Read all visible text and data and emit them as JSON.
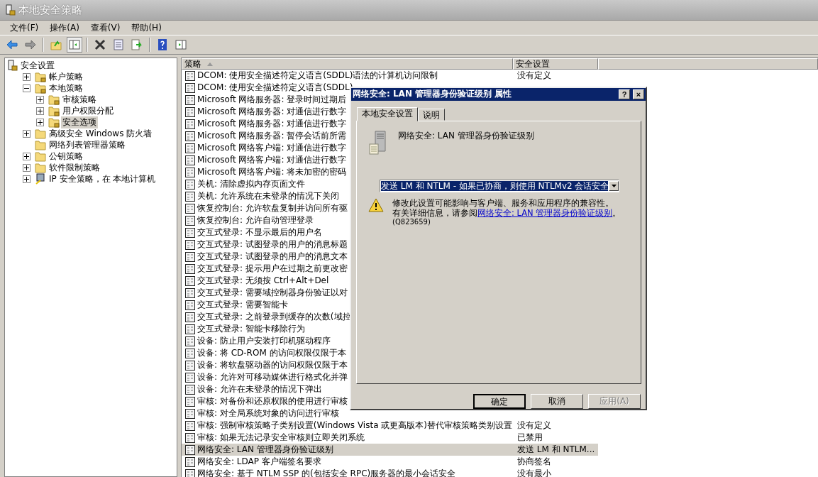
{
  "window": {
    "title": "本地安全策略"
  },
  "menu": [
    "文件(F)",
    "操作(A)",
    "查看(V)",
    "帮助(H)"
  ],
  "tree": [
    {
      "label": "安全设置",
      "kind": "root",
      "selected": false,
      "children": [
        {
          "label": "帐户策略",
          "kind": "policy",
          "selected": false,
          "expanded": false
        },
        {
          "label": "本地策略",
          "kind": "policy",
          "selected": false,
          "expanded": true,
          "children": [
            {
              "label": "审核策略",
              "kind": "policy",
              "selected": false,
              "expanded": false
            },
            {
              "label": "用户权限分配",
              "kind": "policy",
              "selected": false,
              "expanded": false
            },
            {
              "label": "安全选项",
              "kind": "policy",
              "selected": true,
              "expanded": false
            }
          ]
        },
        {
          "label": "高级安全 Windows 防火墙",
          "kind": "folder",
          "selected": false,
          "expanded": false
        },
        {
          "label": "网络列表管理器策略",
          "kind": "leaf",
          "selected": false
        },
        {
          "label": "公钥策略",
          "kind": "folder",
          "selected": false,
          "expanded": false
        },
        {
          "label": "软件限制策略",
          "kind": "folder",
          "selected": false,
          "expanded": false
        },
        {
          "label": "IP 安全策略，在 本地计算机",
          "kind": "ip",
          "selected": false,
          "expanded": false
        }
      ]
    }
  ],
  "table": {
    "columns": [
      "策略",
      "安全设置"
    ],
    "rows": [
      {
        "policy": "DCOM: 使用安全描述符定义语言(SDDL)语法的计算机访问限制",
        "setting": "没有定义",
        "selected": false
      },
      {
        "policy": "DCOM: 使用安全描述符定义语言(SDDL)",
        "selected": false
      },
      {
        "policy": "Microsoft 网络服务器: 登录时间过期后",
        "selected": false
      },
      {
        "policy": "Microsoft 网络服务器: 对通信进行数字",
        "selected": false
      },
      {
        "policy": "Microsoft 网络服务器: 对通信进行数字",
        "selected": false
      },
      {
        "policy": "Microsoft 网络服务器: 暂停会话前所需",
        "selected": false
      },
      {
        "policy": "Microsoft 网络客户端: 对通信进行数字",
        "selected": false
      },
      {
        "policy": "Microsoft 网络客户端: 对通信进行数字",
        "selected": false
      },
      {
        "policy": "Microsoft 网络客户端: 将未加密的密码",
        "selected": false
      },
      {
        "policy": "关机: 清除虚拟内存页面文件",
        "selected": false
      },
      {
        "policy": "关机: 允许系统在未登录的情况下关闭",
        "selected": false
      },
      {
        "policy": "恢复控制台: 允许软盘复制并访问所有驱",
        "selected": false
      },
      {
        "policy": "恢复控制台: 允许自动管理登录",
        "selected": false
      },
      {
        "policy": "交互式登录: 不显示最后的用户名",
        "selected": false
      },
      {
        "policy": "交互式登录: 试图登录的用户的消息标题",
        "selected": false
      },
      {
        "policy": "交互式登录: 试图登录的用户的消息文本",
        "selected": false
      },
      {
        "policy": "交互式登录: 提示用户在过期之前更改密",
        "selected": false
      },
      {
        "policy": "交互式登录: 无须按 Ctrl+Alt+Del",
        "selected": false
      },
      {
        "policy": "交互式登录: 需要域控制器身份验证以对",
        "selected": false
      },
      {
        "policy": "交互式登录: 需要智能卡",
        "selected": false
      },
      {
        "policy": "交互式登录: 之前登录到缓存的次数(域控",
        "selected": false
      },
      {
        "policy": "交互式登录: 智能卡移除行为",
        "selected": false
      },
      {
        "policy": "设备: 防止用户安装打印机驱动程序",
        "selected": false
      },
      {
        "policy": "设备: 将 CD-ROM 的访问权限仅限于本",
        "selected": false
      },
      {
        "policy": "设备: 将软盘驱动器的访问权限仅限于本",
        "selected": false
      },
      {
        "policy": "设备: 允许对可移动媒体进行格式化并弹",
        "selected": false
      },
      {
        "policy": "设备: 允许在未登录的情况下弹出",
        "selected": false
      },
      {
        "policy": "审核: 对备份和还原权限的使用进行审核",
        "selected": false
      },
      {
        "policy": "审核: 对全局系统对象的访问进行审核",
        "selected": false
      },
      {
        "policy": "审核: 强制审核策略子类别设置(Windows Vista 或更高版本)替代审核策略类别设置",
        "setting": "没有定义",
        "selected": false
      },
      {
        "policy": "审核: 如果无法记录安全审核则立即关闭系统",
        "setting": "已禁用",
        "selected": false
      },
      {
        "policy": "网络安全: LAN 管理器身份验证级别",
        "setting": "发送 LM 和 NTLM...",
        "selected": true
      },
      {
        "policy": "网络安全: LDAP 客户端签名要求",
        "setting": "协商签名",
        "selected": false
      },
      {
        "policy": "网络安全: 基于 NTLM SSP 的(包括安全 RPC)服务器的最小会话安全",
        "setting": "没有最小",
        "selected": false
      }
    ]
  },
  "dialog": {
    "title": "网络安全: LAN 管理器身份验证级别 属性",
    "title_buttons": [
      "?",
      "×"
    ],
    "tabs": [
      {
        "label": "本地安全设置",
        "selected": true
      },
      {
        "label": "说明",
        "selected": false
      }
    ],
    "policy_name": "网络安全: LAN 管理器身份验证级别",
    "dropdown": {
      "value": "发送 LM 和 NTLM - 如果已协商，则使用 NTLMv2 会话安全"
    },
    "warning": "修改此设置可能影响与客户端、服务和应用程序的兼容性。",
    "info_prefix": "有关详细信息，请参阅",
    "info_link": "网络安全: LAN 管理器身份验证级别",
    "info_suffix": "。",
    "kb": "(Q823659)",
    "buttons": [
      {
        "label": "确定",
        "disabled": false,
        "default": true
      },
      {
        "label": "取消",
        "disabled": false,
        "default": false
      },
      {
        "label": "应用(A)",
        "disabled": true,
        "default": false
      }
    ]
  }
}
